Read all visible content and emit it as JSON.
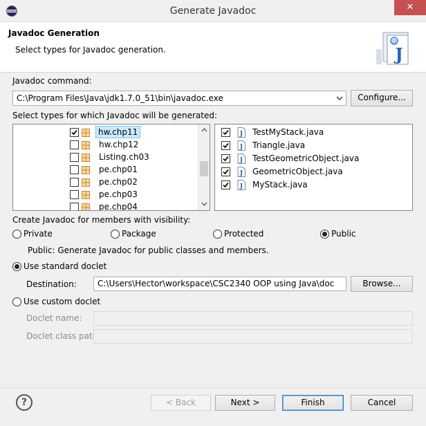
{
  "window": {
    "title": "Generate Javadoc",
    "close_glyph": "✕"
  },
  "header": {
    "title": "Javadoc Generation",
    "description": "Select types for Javadoc generation.",
    "banner_icon": "javadoc-wizard-banner-icon"
  },
  "command": {
    "label": "Javadoc command:",
    "value": "C:\\Program Files\\Java\\jdk1.7.0_51\\bin\\javadoc.exe",
    "configure_label": "Configure..."
  },
  "types": {
    "label": "Select types for which Javadoc will be generated:",
    "packages": [
      {
        "name": "hw.chp11",
        "checked": true,
        "selected": true
      },
      {
        "name": "hw.chp12",
        "checked": false,
        "selected": false
      },
      {
        "name": "Listing.ch03",
        "checked": false,
        "selected": false
      },
      {
        "name": "pe.chp01",
        "checked": false,
        "selected": false
      },
      {
        "name": "pe.chp02",
        "checked": false,
        "selected": false
      },
      {
        "name": "pe.chp03",
        "checked": false,
        "selected": false
      },
      {
        "name": "pe.chp04",
        "checked": false,
        "selected": false
      }
    ],
    "files": [
      {
        "name": "TestMyStack.java",
        "checked": true
      },
      {
        "name": "Triangle.java",
        "checked": true
      },
      {
        "name": "TestGeometricObject.java",
        "checked": true
      },
      {
        "name": "GeometricObject.java",
        "checked": true
      },
      {
        "name": "MyStack.java",
        "checked": true
      }
    ]
  },
  "visibility": {
    "label": "Create Javadoc for members with visibility:",
    "options": [
      {
        "label": "Private",
        "selected": false
      },
      {
        "label": "Package",
        "selected": false
      },
      {
        "label": "Protected",
        "selected": false
      },
      {
        "label": "Public",
        "selected": true
      }
    ],
    "description": "Public: Generate Javadoc for public classes and members."
  },
  "standard_doclet": {
    "label": "Use standard doclet",
    "selected": true,
    "destination_label": "Destination:",
    "destination_value": "C:\\Users\\Hector\\workspace\\CSC2340 OOP using Java\\doc",
    "browse_label": "Browse..."
  },
  "custom_doclet": {
    "label": "Use custom doclet",
    "selected": false,
    "name_label": "Doclet name:",
    "classpath_label": "Doclet class path:"
  },
  "footer": {
    "help_glyph": "?",
    "back_label": "< Back",
    "next_label": "Next >",
    "finish_label": "Finish",
    "cancel_label": "Cancel"
  },
  "colors": {
    "selection": "#cce8ff",
    "close_button": "#c75050",
    "java_icon": "#2b63b5",
    "package_icon": "#c9882b"
  }
}
